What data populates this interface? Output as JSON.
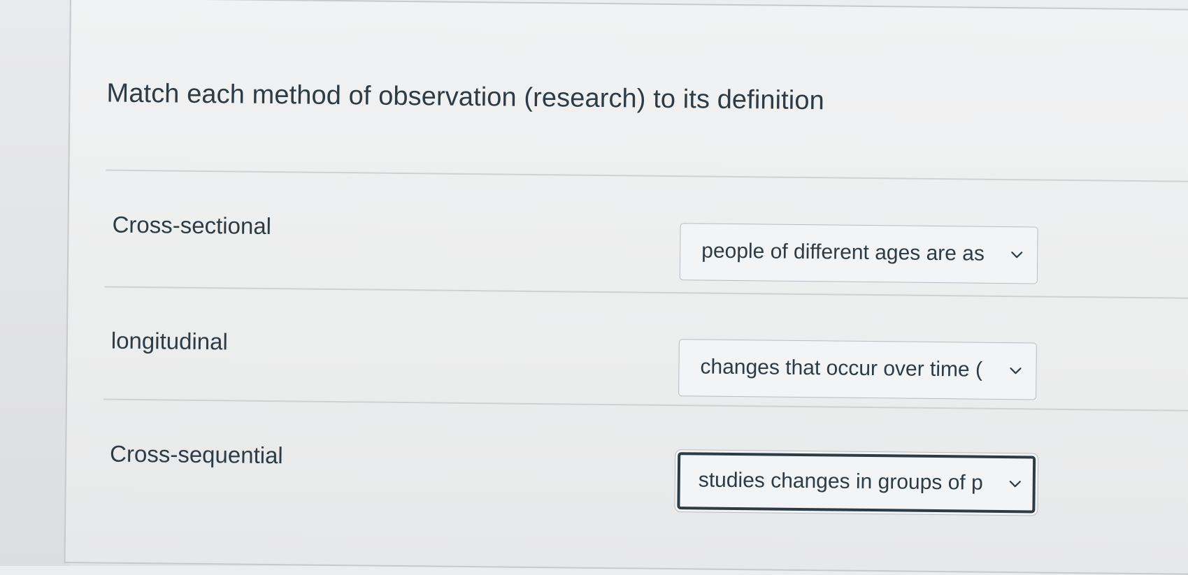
{
  "question": {
    "text": "Match each method of observation (research) to its definition"
  },
  "matches": [
    {
      "term": "Cross-sectional",
      "selected": "people of different ages are as",
      "icon": "chevron-down-icon"
    },
    {
      "term": "longitudinal",
      "selected": "changes that occur over time (",
      "icon": "chevron-down-icon"
    },
    {
      "term": "Cross-sequential",
      "selected": "studies changes in groups of p",
      "icon": "chevron-down-icon"
    }
  ],
  "colors": {
    "text": "#2d3b45",
    "border": "#b9bcc0",
    "focus_border": "#2d3b45",
    "background": "#eceded"
  }
}
